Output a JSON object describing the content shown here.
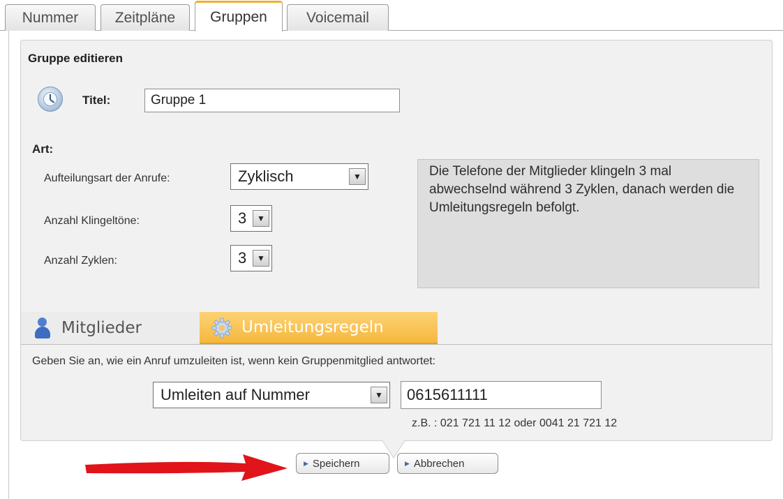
{
  "tabs": [
    {
      "label": "Nummer",
      "active": false
    },
    {
      "label": "Zeitpläne",
      "active": false
    },
    {
      "label": "Gruppen",
      "active": true
    },
    {
      "label": "Voicemail",
      "active": false
    }
  ],
  "panel": {
    "title": "Gruppe editieren",
    "titel_label": "Titel:",
    "titel_value": "Gruppe 1",
    "art_label": "Art:",
    "aufteilung_label": "Aufteilungsart der Anrufe:",
    "aufteilung_value": "Zyklisch",
    "klingeltoene_label": "Anzahl Klingeltöne:",
    "klingeltoene_value": "3",
    "zyklen_label": "Anzahl Zyklen:",
    "zyklen_value": "3",
    "info_text": "Die Telefone der Mitglieder klingeln 3 mal abwechselnd während 3 Zyklen, danach werden die Umleitungsregeln befolgt."
  },
  "subtabs": {
    "mitglieder": "Mitglieder",
    "umleitungsregeln": "Umleitungsregeln",
    "active": "Umleitungsregeln"
  },
  "umleitung": {
    "description": "Geben Sie an, wie ein Anruf umzuleiten ist, wenn kein Gruppenmitglied antwortet:",
    "mode_value": "Umleiten auf Nummer",
    "number_value": "0615611111",
    "example": "z.B. : 021 721 11 12 oder 0041 21 721 12"
  },
  "buttons": {
    "save": "Speichern",
    "cancel": "Abbrechen"
  },
  "colors": {
    "active_tab_accent": "#f0b030",
    "subtab_active": "#f5b83f",
    "arrow": "#e0141a"
  }
}
